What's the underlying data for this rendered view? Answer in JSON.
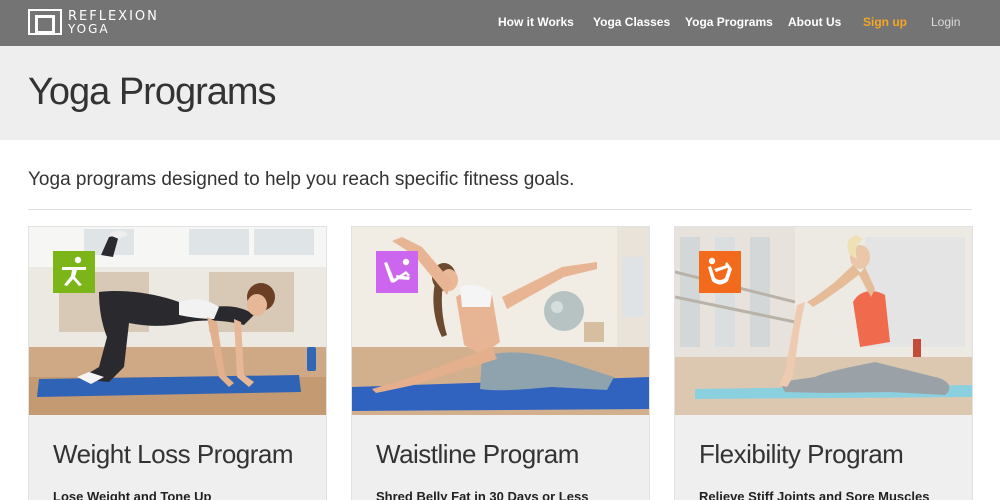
{
  "brand": {
    "line1": "REFLEXION",
    "line2": "YOGA"
  },
  "nav": {
    "items": [
      {
        "label": "How it Works"
      },
      {
        "label": "Yoga Classes"
      },
      {
        "label": "Yoga Programs"
      },
      {
        "label": "About Us"
      },
      {
        "label": "Sign up"
      },
      {
        "label": "Login"
      }
    ],
    "signup_color": "#f5a623"
  },
  "page": {
    "title": "Yoga Programs",
    "intro": "Yoga programs designed to help you reach specific fitness goals."
  },
  "programs": [
    {
      "title": "Weight Loss Program",
      "subtitle": "Lose Weight and Tone Up",
      "badge_color": "#7cb518",
      "icon": "warrior-pose-icon"
    },
    {
      "title": "Waistline Program",
      "subtitle": "Shred Belly Fat in 30 Days or Less",
      "badge_color": "#cc66ee",
      "icon": "boat-pose-icon"
    },
    {
      "title": "Flexibility Program",
      "subtitle": "Relieve Stiff Joints and Sore Muscles",
      "badge_color": "#f26a1b",
      "icon": "bow-pose-icon"
    }
  ]
}
